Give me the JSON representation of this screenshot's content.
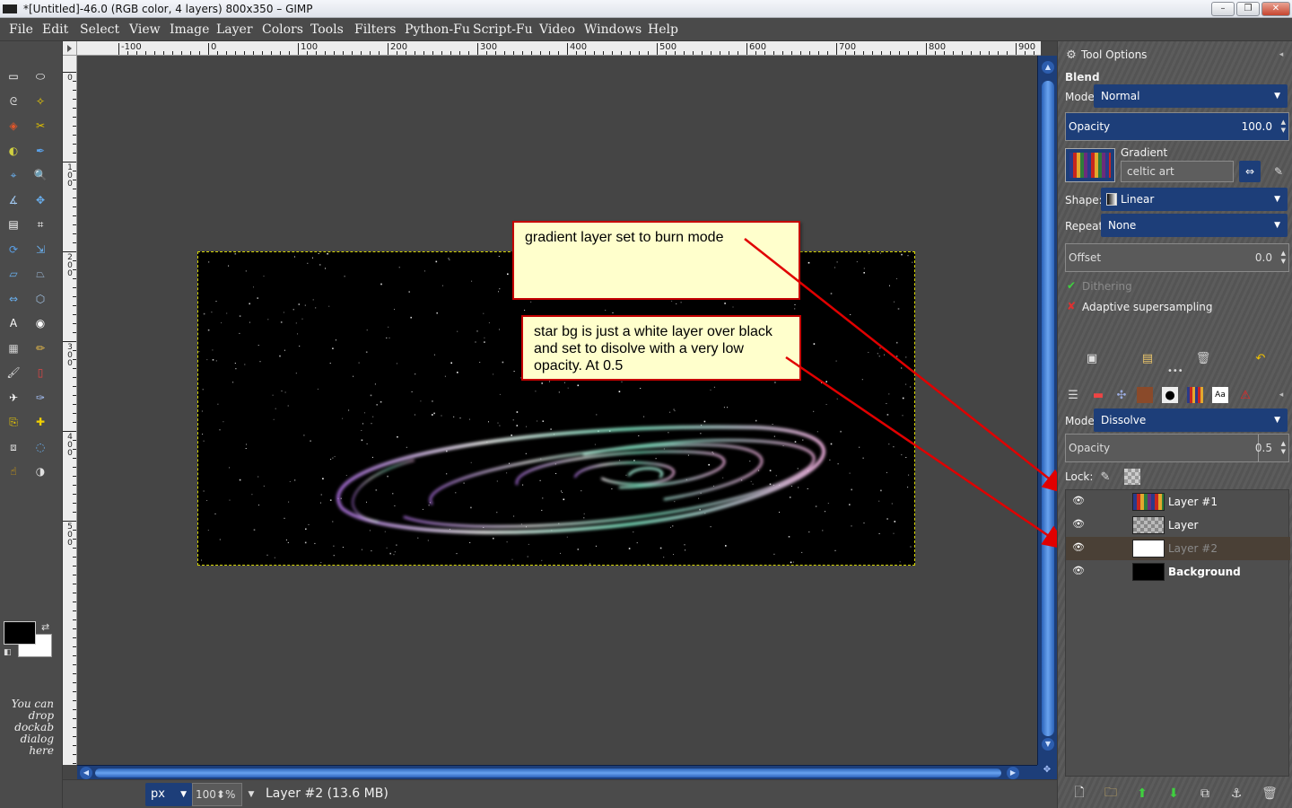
{
  "window": {
    "title": "*[Untitled]-46.0 (RGB color, 4 layers) 800x350 – GIMP",
    "minimize_glyph": "–",
    "restore_glyph": "❐",
    "close_glyph": "✕"
  },
  "menu": [
    "File",
    "Edit",
    "Select",
    "View",
    "Image",
    "Layer",
    "Colors",
    "Tools",
    "Filters",
    "Python-Fu",
    "Script-Fu",
    "Video",
    "Windows",
    "Help"
  ],
  "ruler": {
    "h_labels": [
      "-100",
      "0",
      "100",
      "200",
      "300",
      "400",
      "500",
      "600",
      "700",
      "800",
      "900"
    ],
    "v_labels": [
      "0",
      "100",
      "200",
      "300",
      "400",
      "500"
    ]
  },
  "toolbox": {
    "drop_note": "You can drop dockab dialog here",
    "tools": [
      "rect-select-icon",
      "ellipse-select-icon",
      "free-select-icon",
      "fuzzy-select-icon",
      "by-color-select-icon",
      "scissors-icon",
      "foreground-select-icon",
      "paths-icon",
      "color-picker-icon",
      "zoom-icon",
      "measure-icon",
      "move-icon",
      "align-icon",
      "crop-icon",
      "rotate-icon",
      "scale-icon",
      "shear-icon",
      "perspective-icon",
      "flip-icon",
      "cage-icon",
      "text-icon",
      "bucket-fill-icon",
      "blend-icon",
      "pencil-icon",
      "paintbrush-icon",
      "eraser-icon",
      "airbrush-icon",
      "ink-icon",
      "clone-icon",
      "heal-icon",
      "perspective-clone-icon",
      "blur-icon",
      "smudge-icon",
      "dodge-burn-icon"
    ]
  },
  "statusbar": {
    "unit": "px",
    "zoom": "100",
    "zoom_suffix": "%",
    "message": "Layer #2 (13.6 MB)"
  },
  "canvas": {
    "image_width": 800,
    "image_height": 350,
    "background_color": "#000000",
    "selection_color": "#d6d600"
  },
  "callouts": [
    {
      "text": "gradient layer set to burn mode"
    },
    {
      "text": "star bg is just a white layer over black and set to disolve with a very low opacity.  At  0.5"
    }
  ],
  "tool_options": {
    "panel_title": "Tool Options",
    "tool_name": "Blend",
    "mode_label": "Mode:",
    "mode_value": "Normal",
    "opacity_label": "Opacity",
    "opacity_value": "100.0",
    "gradient_label": "Gradient",
    "gradient_value": "celtic art",
    "shape_label": "Shape:",
    "shape_value": "Linear",
    "repeat_label": "Repeat:",
    "repeat_value": "None",
    "offset_label": "Offset",
    "offset_value": "0.0",
    "dithering_label": "Dithering",
    "dithering_checked": true,
    "adaptive_label": "Adaptive supersampling",
    "adaptive_checked": false
  },
  "layers_panel": {
    "mode_label": "Mode:",
    "mode_value": "Dissolve",
    "opacity_label": "Opacity",
    "opacity_value": "0.5",
    "lock_label": "Lock:",
    "layers": [
      {
        "name": "Layer #1",
        "visible": true,
        "thumb": "gradient",
        "active": false
      },
      {
        "name": "Layer",
        "visible": true,
        "thumb": "transparent",
        "active": false
      },
      {
        "name": "Layer #2",
        "visible": true,
        "thumb": "white",
        "active": true
      },
      {
        "name": "Background",
        "visible": true,
        "thumb": "black",
        "active": false
      }
    ]
  },
  "colors": {
    "accent_blue": "#1d3e79",
    "callout_fill": "#ffffcc",
    "callout_border": "#c40000",
    "arrow": "#e00000"
  }
}
